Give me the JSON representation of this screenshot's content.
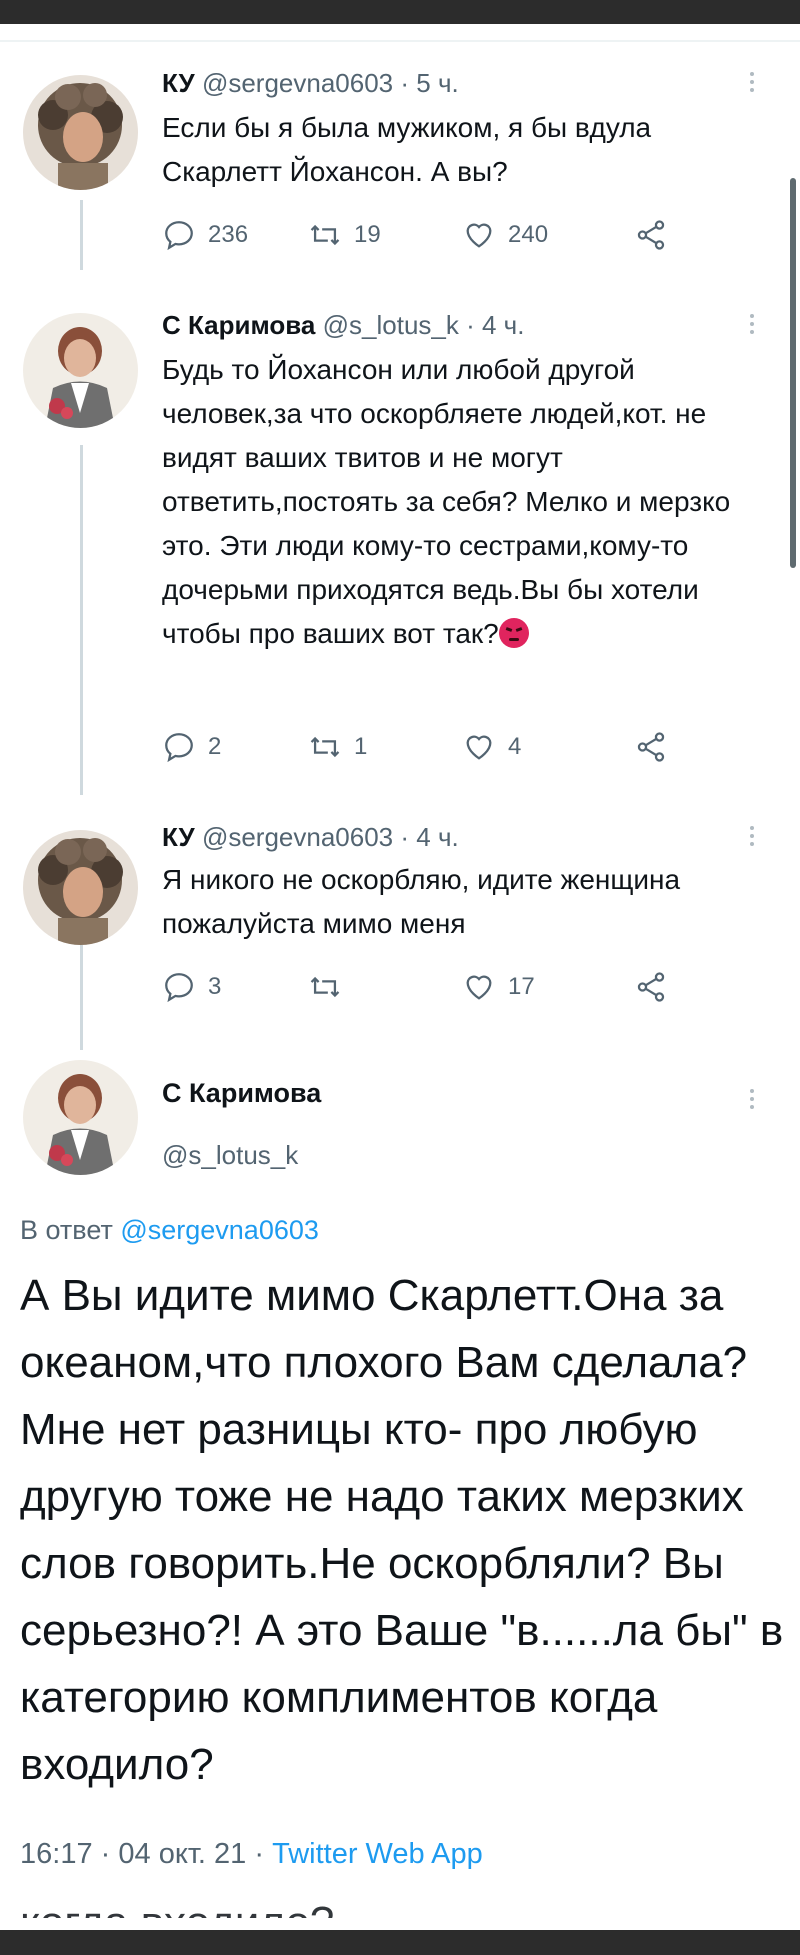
{
  "tweets": [
    {
      "name": "КУ",
      "handle": "@sergevna0603",
      "time": "5 ч.",
      "text": "Если бы я была мужиком, я бы вдула Скарлетт Йохансон. А вы?",
      "replies": "236",
      "retweets": "19",
      "likes": "240",
      "avatar_icon": "curly-hair-woman-avatar"
    },
    {
      "name": "С Каримова",
      "handle": "@s_lotus_k",
      "time": "4 ч.",
      "text": "Будь то Йохансон или любой другой человек,за что оскорбляете людей,кот. не видят ваших твитов и не могут ответить,постоять за себя? Мелко и мерзко это. Эти люди кому-то сестрами,кому-то дочерьми приходятся ведь.Вы бы хотели чтобы про ваших вот так?",
      "emoji": "angry-face",
      "replies": "2",
      "retweets": "1",
      "likes": "4",
      "avatar_icon": "woman-with-flowers-avatar"
    },
    {
      "name": "КУ",
      "handle": "@sergevna0603",
      "time": "4 ч.",
      "text": "Я никого не оскорбляю, идите женщина пожалуйста мимо меня",
      "replies": "3",
      "retweets": "",
      "likes": "17",
      "avatar_icon": "curly-hair-woman-avatar"
    }
  ],
  "focal": {
    "name": "С Каримова",
    "handle": "@s_lotus_k",
    "reply_prefix": "В ответ",
    "reply_handle": "@sergevna0603",
    "text": "А Вы идите мимо Скарлетт.Она за океаном,что плохого Вам сделала? Мне нет разницы кто- про любую другую тоже не надо таких мерзких слов говорить.Не оскорбляли? Вы серьезно?! А это Ваше \"в......ла бы\" в категорию комплиментов когда входило?",
    "time": "16:17",
    "date": "04 окт. 21",
    "source": "Twitter Web App",
    "separator": "·"
  },
  "cropped_text": "когда входило?",
  "colors": {
    "text": "#0f1419",
    "muted": "#536471",
    "link": "#1d9bf0",
    "thread_line": "#cfd9de",
    "dark_bar": "#2c2c2c"
  },
  "icons": [
    "reply-icon",
    "retweet-icon",
    "like-icon",
    "share-icon",
    "more-icon"
  ]
}
